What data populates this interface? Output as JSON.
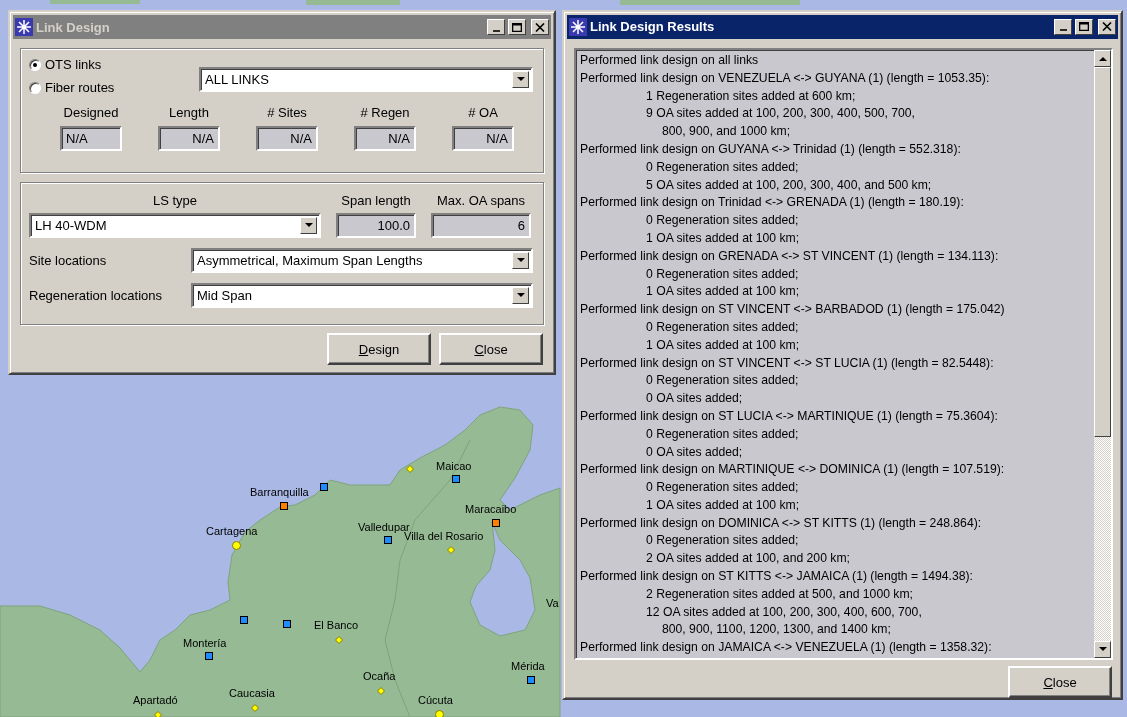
{
  "map": {
    "places": [
      {
        "kind": "diamond",
        "color": "#ffff00"
      },
      {
        "name": "Maicao",
        "kind": "square",
        "color": "#1e8cff"
      },
      {
        "kind": "square",
        "color": "#1e8cff"
      },
      {
        "name": "Barranquilla",
        "kind": "square",
        "color": "#ff8000"
      },
      {
        "name": "Maracaibo",
        "kind": "square",
        "color": "#ff8000"
      },
      {
        "name": "Valledupar",
        "kind": "square",
        "color": "#1e8cff"
      },
      {
        "name": "Cartagena",
        "kind": "circle",
        "color": "#ffff00"
      },
      {
        "name": "Villa del Rosario",
        "kind": "diamond",
        "color": "#ffff00"
      },
      {
        "name": "Va"
      },
      {
        "kind": "square",
        "color": "#1e8cff"
      },
      {
        "kind": "square",
        "color": "#1e8cff"
      },
      {
        "name": "El Banco",
        "kind": "diamond",
        "color": "#ffff00"
      },
      {
        "name": "Montería",
        "kind": "square",
        "color": "#1e8cff"
      },
      {
        "name": "Mérida",
        "kind": "square",
        "color": "#1e8cff"
      },
      {
        "name": "Ocaña",
        "kind": "diamond",
        "color": "#ffff00"
      },
      {
        "name": "Caucasia",
        "kind": "diamond",
        "color": "#ffff00"
      },
      {
        "name": "Apartadó",
        "kind": "diamond",
        "color": "#ffff00"
      },
      {
        "name": "Cúcuta",
        "kind": "circle",
        "color": "#ffff00"
      }
    ]
  },
  "link_design_window": {
    "title": "Link Design",
    "active": false,
    "link_scope": [
      {
        "label": "OTS links",
        "selected": true
      },
      {
        "label": "Fiber routes",
        "selected": false
      }
    ],
    "link_dropdown": {
      "value": "ALL LINKS"
    },
    "stats": [
      {
        "label": "Designed",
        "value": "N/A"
      },
      {
        "label": "Length",
        "value": "N/A"
      },
      {
        "label": "# Sites",
        "value": "N/A"
      },
      {
        "label": "# Regen",
        "value": "N/A"
      },
      {
        "label": "# OA",
        "value": "N/A"
      }
    ],
    "ls_type": {
      "label": "LS type",
      "value": "LH 40-WDM"
    },
    "span_length": {
      "label": "Span length",
      "value": "100.0"
    },
    "max_oa_spans": {
      "label": "Max. OA spans",
      "value": "6"
    },
    "site_locations": {
      "label": "Site locations",
      "value": "Asymmetrical, Maximum Span Lengths"
    },
    "regeneration_locations": {
      "label": "Regeneration locations",
      "value": "Mid Span"
    },
    "buttons": [
      "Design",
      "Close"
    ]
  },
  "results_window": {
    "title": "Link Design Results",
    "active": true,
    "lines": [
      {
        "kind": "entry",
        "text": "Performed link design on all links"
      },
      {
        "kind": "entry",
        "text": "Performed link design on VENEZUELA <-> GUYANA (1) (length = 1053.35):"
      },
      {
        "kind": "detail",
        "text": "1 Regeneration sites added at 600 km;"
      },
      {
        "kind": "detail",
        "text": "9 OA sites added at 100, 200, 300, 400, 500, 700,"
      },
      {
        "kind": "continuation",
        "text": "800, 900, and 1000 km;"
      },
      {
        "kind": "entry",
        "text": "Performed link design on GUYANA <-> Trinidad (1) (length = 552.318):"
      },
      {
        "kind": "detail",
        "text": "0 Regeneration sites added;"
      },
      {
        "kind": "detail",
        "text": "5 OA sites added at 100, 200, 300, 400, and 500 km;"
      },
      {
        "kind": "entry",
        "text": "Performed link design on Trinidad <-> GRENADA (1) (length = 180.19):"
      },
      {
        "kind": "detail",
        "text": "0 Regeneration sites added;"
      },
      {
        "kind": "detail",
        "text": "1 OA sites added at 100 km;"
      },
      {
        "kind": "entry",
        "text": "Performed link design on GRENADA <-> ST VINCENT (1) (length = 134.113):"
      },
      {
        "kind": "detail",
        "text": "0 Regeneration sites added;"
      },
      {
        "kind": "detail",
        "text": "1 OA sites added at 100 km;"
      },
      {
        "kind": "entry",
        "text": "Performed link design on ST VINCENT <-> BARBADOD (1) (length = 175.042)"
      },
      {
        "kind": "detail",
        "text": "0 Regeneration sites added;"
      },
      {
        "kind": "detail",
        "text": "1 OA sites added at 100 km;"
      },
      {
        "kind": "entry",
        "text": "Performed link design on ST VINCENT <-> ST LUCIA (1) (length = 82.5448):"
      },
      {
        "kind": "detail",
        "text": "0 Regeneration sites added;"
      },
      {
        "kind": "detail",
        "text": "0 OA sites added;"
      },
      {
        "kind": "entry",
        "text": "Performed link design on ST LUCIA <-> MARTINIQUE (1) (length = 75.3604):"
      },
      {
        "kind": "detail",
        "text": "0 Regeneration sites added;"
      },
      {
        "kind": "detail",
        "text": "0 OA sites added;"
      },
      {
        "kind": "entry",
        "text": "Performed link design on MARTINIQUE <-> DOMINICA (1) (length = 107.519):"
      },
      {
        "kind": "detail",
        "text": "0 Regeneration sites added;"
      },
      {
        "kind": "detail",
        "text": "1 OA sites added at 100 km;"
      },
      {
        "kind": "entry",
        "text": "Performed link design on DOMINICA <-> ST KITTS (1) (length = 248.864):"
      },
      {
        "kind": "detail",
        "text": "0 Regeneration sites added;"
      },
      {
        "kind": "detail",
        "text": "2 OA sites added at 100, and 200 km;"
      },
      {
        "kind": "entry",
        "text": "Performed link design on ST KITTS <-> JAMAICA (1) (length = 1494.38):"
      },
      {
        "kind": "detail",
        "text": "2 Regeneration sites added at 500, and 1000 km;"
      },
      {
        "kind": "detail",
        "text": "12 OA sites added at 100, 200, 300, 400, 600, 700,"
      },
      {
        "kind": "continuation",
        "text": "800, 900, 1100, 1200, 1300, and 1400 km;"
      },
      {
        "kind": "entry",
        "text": "Performed link design on JAMAICA <-> VENEZUELA (1) (length = 1358.32):"
      }
    ],
    "buttons": [
      "Close"
    ]
  }
}
